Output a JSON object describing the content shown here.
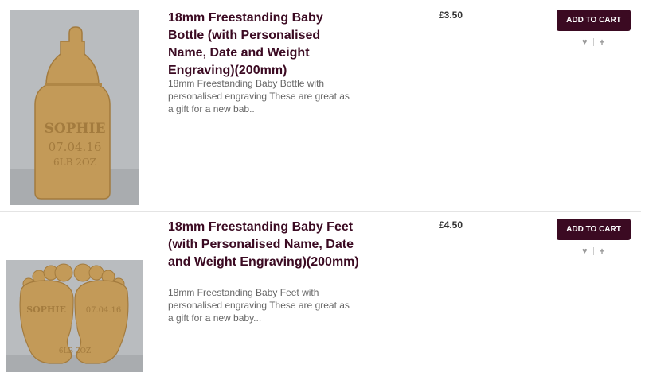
{
  "products": [
    {
      "title": "18mm Freestanding Baby Bottle (with Personalised Name, Date and Weight Engraving)(200mm)",
      "description": "18mm Freestanding Baby Bottle with personalised engraving These are great as a gift for a new bab..",
      "price": "£3.50",
      "cart_label": "ADD TO CART",
      "engraving": {
        "name": "SOPHIE",
        "date": "07.04.16",
        "weight": "6LB 2OZ"
      }
    },
    {
      "title": "18mm Freestanding Baby Feet (with Personalised Name, Date and Weight Engraving)(200mm)",
      "description": "18mm Freestanding Baby Feet with personalised engraving These are great as a gift for a new baby...",
      "price": "£4.50",
      "cart_label": "ADD TO CART",
      "engraving": {
        "name": "SOPHIE",
        "date": "07.04.16",
        "weight": "6LB 2OZ"
      }
    }
  ],
  "icons": {
    "wishlist": "heart-icon",
    "compare": "plus-icon"
  },
  "colors": {
    "accent": "#3b0a22",
    "wood": "#c39a58",
    "photo_bg": "#b9bcbf"
  }
}
